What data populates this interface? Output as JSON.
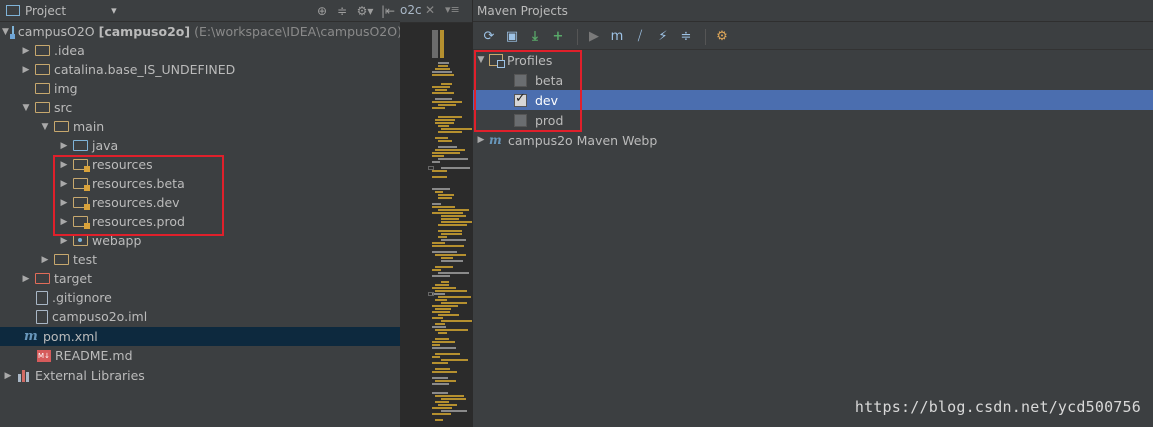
{
  "project_panel": {
    "title": "Project",
    "dropdown": "▾",
    "header_icons": [
      "⊕",
      "≑",
      "⚙▾",
      "|⇤"
    ],
    "tree": [
      {
        "label": "campusO2O",
        "suffix_bold": "[campuso2o]",
        "suffix": "(E:\\workspace\\IDEA\\campusO2O)",
        "expanded": true,
        "icon": "module-icon"
      },
      {
        "label": ".idea",
        "expanded": false,
        "icon": "folder-icon"
      },
      {
        "label": "catalina.base_IS_UNDEFINED",
        "expanded": false,
        "icon": "folder-icon"
      },
      {
        "label": "img",
        "icon": "folder-icon"
      },
      {
        "label": "src",
        "expanded": true,
        "icon": "folder-icon"
      },
      {
        "label": "main",
        "expanded": true,
        "icon": "folder-icon"
      },
      {
        "label": "java",
        "expanded": false,
        "icon": "source-folder-icon"
      },
      {
        "label": "resources",
        "expanded": false,
        "icon": "resources-folder-icon"
      },
      {
        "label": "resources.beta",
        "expanded": false,
        "icon": "resources-folder-icon"
      },
      {
        "label": "resources.dev",
        "expanded": false,
        "icon": "resources-folder-icon"
      },
      {
        "label": "resources.prod",
        "expanded": false,
        "icon": "resources-folder-icon"
      },
      {
        "label": "webapp",
        "expanded": false,
        "icon": "web-folder-icon"
      },
      {
        "label": "test",
        "expanded": false,
        "icon": "folder-icon"
      },
      {
        "label": "target",
        "expanded": false,
        "icon": "excluded-folder-icon"
      },
      {
        "label": ".gitignore",
        "icon": "file-icon"
      },
      {
        "label": "campuso2o.iml",
        "icon": "file-icon"
      },
      {
        "label": "pom.xml",
        "icon": "maven-icon",
        "selected": true
      },
      {
        "label": "README.md",
        "icon": "markdown-icon"
      },
      {
        "label": "External Libraries",
        "expanded": false,
        "icon": "libraries-icon"
      }
    ]
  },
  "editor": {
    "tab_label": "o2c",
    "tab_close": "✕",
    "tab_menu": "▾≡"
  },
  "maven_panel": {
    "title": "Maven Projects",
    "toolbar_icons": [
      "reimport-icon",
      "generate-sources-icon",
      "download-icon",
      "add-icon",
      "run-icon",
      "execute-goal-icon",
      "toggle-offline-icon",
      "skip-tests-icon",
      "collapse-all-icon",
      "settings-icon"
    ],
    "profiles_label": "Profiles",
    "profiles": [
      {
        "label": "beta",
        "checked": false,
        "selected": false
      },
      {
        "label": "dev",
        "checked": true,
        "selected": true
      },
      {
        "label": "prod",
        "checked": false,
        "selected": false
      }
    ],
    "project_label": "campus2o Maven Webp"
  },
  "watermark": "https://blog.csdn.net/ycd500756",
  "colors": {
    "highlight_box": "#e0202b",
    "selection_blue": "#4b6eaf",
    "selected_row_dark": "#0d293e"
  }
}
